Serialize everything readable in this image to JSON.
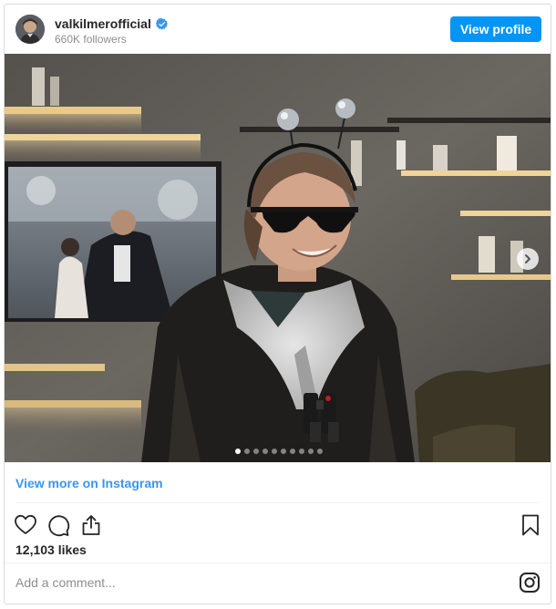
{
  "header": {
    "username": "valkilmerofficial",
    "verified": true,
    "followers": "660K followers",
    "view_profile_label": "View profile"
  },
  "carousel": {
    "slide_count": 10,
    "active_index": 0,
    "icons": {
      "next": "chevron-right-icon"
    }
  },
  "view_more_label": "View more on Instagram",
  "actions": {
    "icons": [
      "heart-icon",
      "comment-icon",
      "share-icon",
      "bookmark-icon"
    ]
  },
  "likes": "12,103 likes",
  "comment": {
    "placeholder": "Add a comment...",
    "icon": "instagram-icon"
  },
  "colors": {
    "accent": "#0095f6",
    "link": "#3897f0",
    "text": "#262626",
    "muted": "#8e8e8e",
    "verified": "#3897f0"
  }
}
